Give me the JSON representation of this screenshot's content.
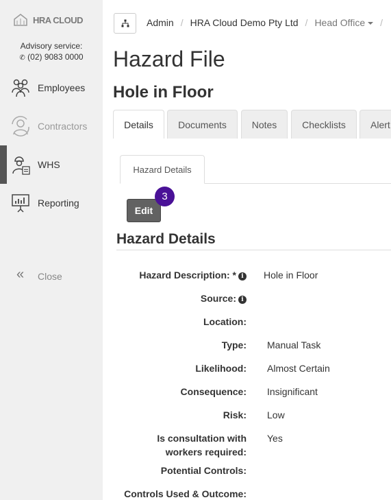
{
  "sidebar": {
    "logo_text": "HRA CLOUD",
    "advisory_label": "Advisory service:",
    "phone": "(02) 9083 0000",
    "items": [
      {
        "label": "Employees",
        "icon": "employees-icon"
      },
      {
        "label": "Contractors",
        "icon": "contractors-icon"
      },
      {
        "label": "WHS",
        "icon": "whs-icon"
      },
      {
        "label": "Reporting",
        "icon": "reporting-icon"
      }
    ],
    "close_label": "Close"
  },
  "breadcrumb": {
    "items": [
      "Admin",
      "HRA Cloud Demo Pty Ltd",
      "Head Office"
    ]
  },
  "page_title": "Hazard File",
  "record_title": "Hole in Floor",
  "tabs": [
    "Details",
    "Documents",
    "Notes",
    "Checklists",
    "Alert"
  ],
  "subtab": "Hazard Details",
  "edit_label": "Edit",
  "step_badge": "3",
  "section_title": "Hazard Details",
  "fields": [
    {
      "label": "Hazard Description: *",
      "value": "Hole in Floor"
    },
    {
      "label": "Source:",
      "value": ""
    },
    {
      "label": "Location:",
      "value": ""
    },
    {
      "label": "Type:",
      "value": "Manual Task"
    },
    {
      "label": "Likelihood:",
      "value": "Almost Certain"
    },
    {
      "label": "Consequence:",
      "value": "Insignificant"
    },
    {
      "label": "Risk:",
      "value": "Low"
    },
    {
      "label": "Is consultation with",
      "label2": "workers required:",
      "value": "Yes"
    },
    {
      "label": "Potential Controls:",
      "value": ""
    },
    {
      "label": "Controls Used & Outcome:",
      "value": ""
    }
  ],
  "colors": {
    "accent_badge": "#4a1197",
    "edit_button": "#626262",
    "sidebar_bg": "#f0f0f0"
  }
}
